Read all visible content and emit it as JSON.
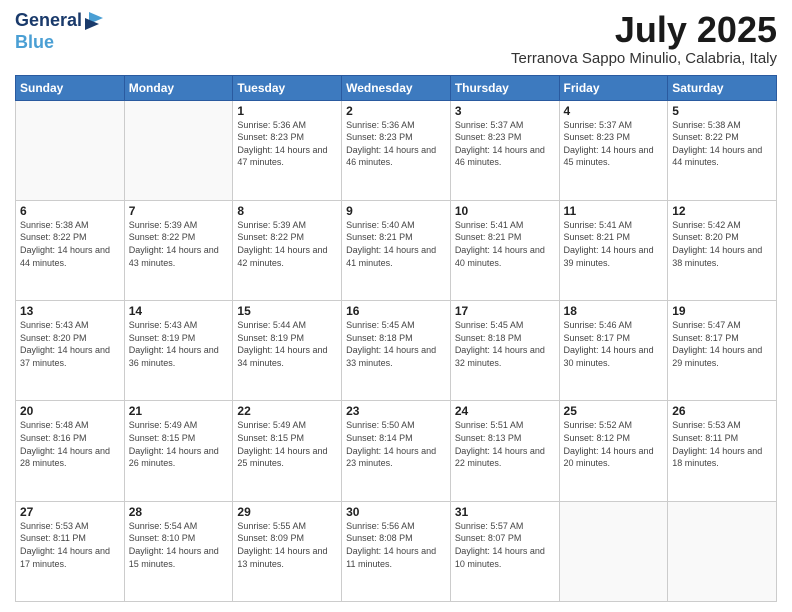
{
  "header": {
    "logo_line1": "General",
    "logo_line2": "Blue",
    "month": "July 2025",
    "location": "Terranova Sappo Minulio, Calabria, Italy"
  },
  "weekdays": [
    "Sunday",
    "Monday",
    "Tuesday",
    "Wednesday",
    "Thursday",
    "Friday",
    "Saturday"
  ],
  "weeks": [
    [
      {
        "day": null
      },
      {
        "day": null
      },
      {
        "day": 1,
        "sunrise": "5:36 AM",
        "sunset": "8:23 PM",
        "daylight": "14 hours and 47 minutes."
      },
      {
        "day": 2,
        "sunrise": "5:36 AM",
        "sunset": "8:23 PM",
        "daylight": "14 hours and 46 minutes."
      },
      {
        "day": 3,
        "sunrise": "5:37 AM",
        "sunset": "8:23 PM",
        "daylight": "14 hours and 46 minutes."
      },
      {
        "day": 4,
        "sunrise": "5:37 AM",
        "sunset": "8:23 PM",
        "daylight": "14 hours and 45 minutes."
      },
      {
        "day": 5,
        "sunrise": "5:38 AM",
        "sunset": "8:22 PM",
        "daylight": "14 hours and 44 minutes."
      }
    ],
    [
      {
        "day": 6,
        "sunrise": "5:38 AM",
        "sunset": "8:22 PM",
        "daylight": "14 hours and 44 minutes."
      },
      {
        "day": 7,
        "sunrise": "5:39 AM",
        "sunset": "8:22 PM",
        "daylight": "14 hours and 43 minutes."
      },
      {
        "day": 8,
        "sunrise": "5:39 AM",
        "sunset": "8:22 PM",
        "daylight": "14 hours and 42 minutes."
      },
      {
        "day": 9,
        "sunrise": "5:40 AM",
        "sunset": "8:21 PM",
        "daylight": "14 hours and 41 minutes."
      },
      {
        "day": 10,
        "sunrise": "5:41 AM",
        "sunset": "8:21 PM",
        "daylight": "14 hours and 40 minutes."
      },
      {
        "day": 11,
        "sunrise": "5:41 AM",
        "sunset": "8:21 PM",
        "daylight": "14 hours and 39 minutes."
      },
      {
        "day": 12,
        "sunrise": "5:42 AM",
        "sunset": "8:20 PM",
        "daylight": "14 hours and 38 minutes."
      }
    ],
    [
      {
        "day": 13,
        "sunrise": "5:43 AM",
        "sunset": "8:20 PM",
        "daylight": "14 hours and 37 minutes."
      },
      {
        "day": 14,
        "sunrise": "5:43 AM",
        "sunset": "8:19 PM",
        "daylight": "14 hours and 36 minutes."
      },
      {
        "day": 15,
        "sunrise": "5:44 AM",
        "sunset": "8:19 PM",
        "daylight": "14 hours and 34 minutes."
      },
      {
        "day": 16,
        "sunrise": "5:45 AM",
        "sunset": "8:18 PM",
        "daylight": "14 hours and 33 minutes."
      },
      {
        "day": 17,
        "sunrise": "5:45 AM",
        "sunset": "8:18 PM",
        "daylight": "14 hours and 32 minutes."
      },
      {
        "day": 18,
        "sunrise": "5:46 AM",
        "sunset": "8:17 PM",
        "daylight": "14 hours and 30 minutes."
      },
      {
        "day": 19,
        "sunrise": "5:47 AM",
        "sunset": "8:17 PM",
        "daylight": "14 hours and 29 minutes."
      }
    ],
    [
      {
        "day": 20,
        "sunrise": "5:48 AM",
        "sunset": "8:16 PM",
        "daylight": "14 hours and 28 minutes."
      },
      {
        "day": 21,
        "sunrise": "5:49 AM",
        "sunset": "8:15 PM",
        "daylight": "14 hours and 26 minutes."
      },
      {
        "day": 22,
        "sunrise": "5:49 AM",
        "sunset": "8:15 PM",
        "daylight": "14 hours and 25 minutes."
      },
      {
        "day": 23,
        "sunrise": "5:50 AM",
        "sunset": "8:14 PM",
        "daylight": "14 hours and 23 minutes."
      },
      {
        "day": 24,
        "sunrise": "5:51 AM",
        "sunset": "8:13 PM",
        "daylight": "14 hours and 22 minutes."
      },
      {
        "day": 25,
        "sunrise": "5:52 AM",
        "sunset": "8:12 PM",
        "daylight": "14 hours and 20 minutes."
      },
      {
        "day": 26,
        "sunrise": "5:53 AM",
        "sunset": "8:11 PM",
        "daylight": "14 hours and 18 minutes."
      }
    ],
    [
      {
        "day": 27,
        "sunrise": "5:53 AM",
        "sunset": "8:11 PM",
        "daylight": "14 hours and 17 minutes."
      },
      {
        "day": 28,
        "sunrise": "5:54 AM",
        "sunset": "8:10 PM",
        "daylight": "14 hours and 15 minutes."
      },
      {
        "day": 29,
        "sunrise": "5:55 AM",
        "sunset": "8:09 PM",
        "daylight": "14 hours and 13 minutes."
      },
      {
        "day": 30,
        "sunrise": "5:56 AM",
        "sunset": "8:08 PM",
        "daylight": "14 hours and 11 minutes."
      },
      {
        "day": 31,
        "sunrise": "5:57 AM",
        "sunset": "8:07 PM",
        "daylight": "14 hours and 10 minutes."
      },
      {
        "day": null
      },
      {
        "day": null
      }
    ]
  ],
  "labels": {
    "sunrise": "Sunrise:",
    "sunset": "Sunset:",
    "daylight": "Daylight:"
  }
}
